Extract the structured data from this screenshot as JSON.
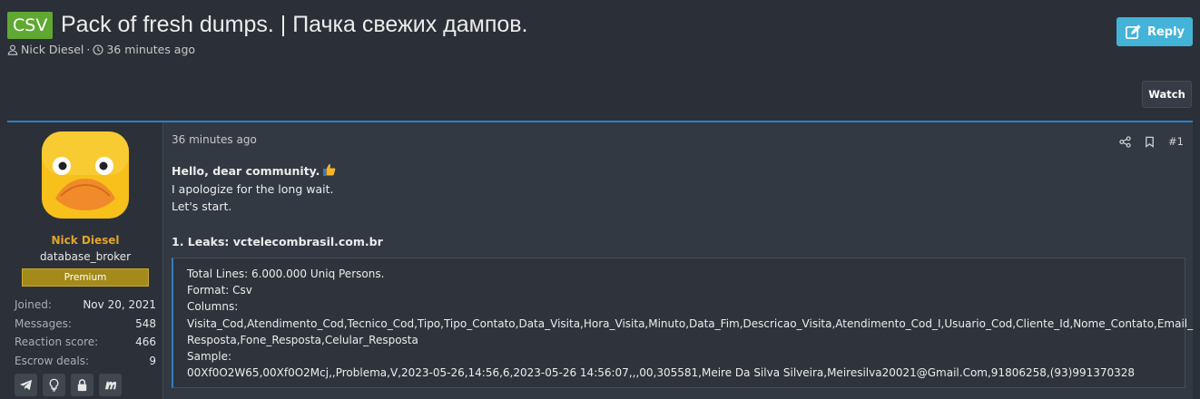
{
  "thread": {
    "prefix": "CSV",
    "title": "Pack of fresh dumps. | Пачка свежих дампов.",
    "author": "Nick Diesel",
    "separator": "·",
    "time": "36 minutes ago",
    "reply_label": "Reply",
    "watch_label": "Watch"
  },
  "user": {
    "name": "Nick Diesel",
    "title": "database_broker",
    "badge": "Premium",
    "stats": [
      {
        "label": "Joined:",
        "value": "Nov 20, 2021"
      },
      {
        "label": "Messages:",
        "value": "548"
      },
      {
        "label": "Reaction score:",
        "value": "466"
      },
      {
        "label": "Escrow deals:",
        "value": "9"
      }
    ],
    "contact_icons": [
      "telegram-icon",
      "lightbulb-icon",
      "lock-icon",
      "matrix-icon"
    ]
  },
  "post": {
    "date": "36 minutes ago",
    "number": "#1",
    "greeting": "Hello, dear community.",
    "line2": "I apologize for the long wait.",
    "line3": "Let's start.",
    "leaks_heading": "1. Leaks: vctelecombrasil.com.br",
    "quote": {
      "line1": "Total Lines: 6.000.000 Uniq Persons.",
      "line2": "Format: Csv",
      "line3": "Columns:",
      "line4": "Visita_Cod,Atendimento_Cod,Tecnico_Cod,Tipo,Tipo_Contato,Data_Visita,Hora_Visita,Minuto,Data_Fim,Descricao_Visita,Atendimento_Cod_I,Usuario_Cod,Cliente_Id,Nome_Contato,Email_",
      "line5": "Resposta,Fone_Resposta,Celular_Resposta",
      "line6": "Sample:",
      "line7": "00Xf0O2W65,00Xf0O2Mcj,,Problema,V,2023-05-26,14:56,6,2023-05-26 14:56:07,,,00,305581,Meire Da Silva Silveira,Meiresilva20021@Gmail.Com,91806258,(93)991370328"
    }
  },
  "colors": {
    "prefix_bg": "#5fa832",
    "reply_bg": "#43b3d8",
    "username": "#e3a52a",
    "premium_bg": "#a48a1a",
    "accent_border": "#2f7fc4"
  }
}
